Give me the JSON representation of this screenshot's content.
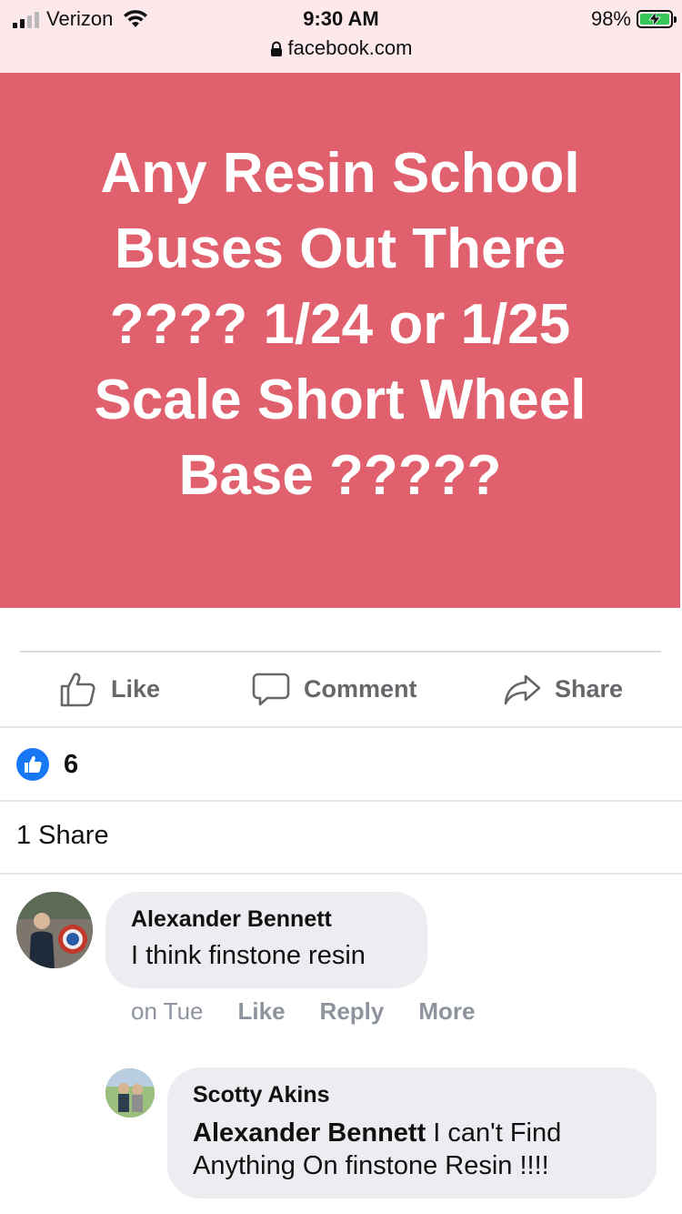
{
  "status_bar": {
    "carrier": "Verizon",
    "time": "9:30 AM",
    "battery_percent": "98%",
    "url": "facebook.com"
  },
  "post": {
    "text_lines": [
      "Any Resin School",
      "Buses Out There",
      "???? 1/24 or 1/25",
      "Scale Short Wheel",
      "Base ?????"
    ],
    "background_color": "#e0606d"
  },
  "actions": {
    "like": "Like",
    "comment": "Comment",
    "share": "Share"
  },
  "reactions": {
    "count": "6"
  },
  "shares_text": "1 Share",
  "comments": [
    {
      "author": "Alexander Bennett",
      "text": "I think finstone resin",
      "time": "on Tue",
      "like": "Like",
      "reply": "Reply",
      "more": "More"
    },
    {
      "author": "Scotty Akins",
      "mention": "Alexander Bennett",
      "text_after_mention": " I can't Find",
      "text_line2": "Anything On finstone Resin !!!!"
    }
  ]
}
